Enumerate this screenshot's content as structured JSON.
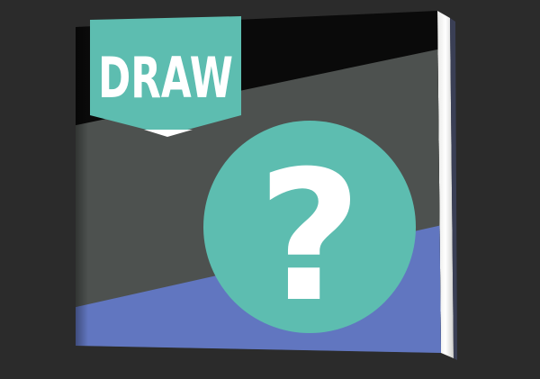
{
  "book": {
    "title": "DRAW",
    "cover_symbol": "?",
    "colors": {
      "background": "#2b2b2b",
      "cover_black": "#0a0a0a",
      "cover_gray": "#4d514f",
      "cover_blue": "#6176c0",
      "teal": "#5dbdb0",
      "white": "#ffffff"
    },
    "icon": "question-mark-icon"
  }
}
